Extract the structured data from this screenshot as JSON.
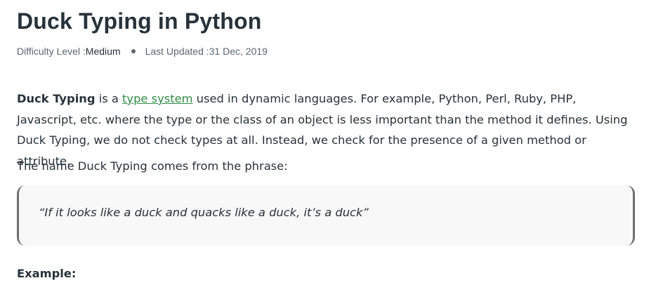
{
  "article": {
    "title": "Duck Typing in Python",
    "meta": {
      "difficulty_label": "Difficulty Level : ",
      "difficulty_value": "Medium",
      "updated_label": "Last Updated : ",
      "updated_value": "31 Dec, 2019"
    },
    "intro": {
      "bold_term": "Duck Typing",
      "text_before_link": " is a ",
      "link_text": "type system",
      "text_after_link": " used in dynamic languages. For example, Python, Perl, Ruby, PHP, Javascript, etc. where the type or the class of an object is less important than the method it defines. Using Duck Typing, we do not check types at all. Instead, we check for the presence of a given method or attribute."
    },
    "phrase_intro": "The name Duck Typing comes from the phrase:",
    "quote": "“If it looks like a duck and quacks like a duck, it’s a duck”",
    "example_heading": "Example:"
  },
  "colors": {
    "text": "#273239",
    "link": "#2f8d46",
    "muted": "#5b6670",
    "quote_bg": "#f8f8f8",
    "quote_border": "#6e6e6e"
  }
}
